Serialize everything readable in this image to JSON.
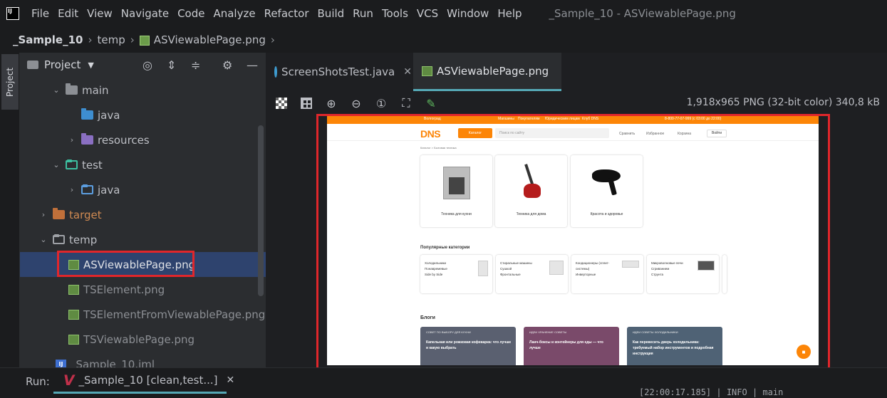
{
  "app": {
    "logo_text": "IJ",
    "window_title": "_Sample_10 - ASViewablePage.png"
  },
  "menu": [
    "File",
    "Edit",
    "View",
    "Navigate",
    "Code",
    "Analyze",
    "Refactor",
    "Build",
    "Run",
    "Tools",
    "VCS",
    "Window",
    "Help"
  ],
  "breadcrumbs": {
    "project": "_Sample_10",
    "folder": "temp",
    "file": "ASViewablePage.png"
  },
  "side_stripe": {
    "project_tab": "Project"
  },
  "project_panel": {
    "title": "Project",
    "tree": [
      {
        "label": "main"
      },
      {
        "label": "java"
      },
      {
        "label": "resources"
      },
      {
        "label": "test"
      },
      {
        "label": "java"
      },
      {
        "label": "target"
      },
      {
        "label": "temp"
      },
      {
        "label": "ASViewablePage.png"
      },
      {
        "label": "TSElement.png"
      },
      {
        "label": "TSElementFromViewablePage.png"
      },
      {
        "label": "TSViewablePage.png"
      },
      {
        "label": "_Sample_10.iml"
      }
    ]
  },
  "editor": {
    "tabs": [
      {
        "label": "ScreenShotsTest.java",
        "icon": "java-class-icon"
      },
      {
        "label": "ASViewablePage.png",
        "icon": "png-file-icon",
        "active": true
      }
    ],
    "image_info": "1,918x965 PNG (32-bit color) 340,8 kB"
  },
  "screenshot_content": {
    "topbar": [
      "Волгоград",
      "Магазины",
      "Покупателям",
      "Юридическим лицам",
      "Клуб DNS",
      "8-800-77-07-999 (с 03:00 до 22:00)"
    ],
    "logo": "DNS",
    "catalog_button": "Каталог",
    "search_placeholder": "Поиск по сайту",
    "nav": [
      "Сравнить",
      "Избранное",
      "Корзина"
    ],
    "login": "Войти",
    "breadcrumb": "Каталог  >  Бытовая техника",
    "categories": [
      "Техника для кухни",
      "Техника для дома",
      "Красота и здоровье"
    ],
    "popular_title": "Популярные категории",
    "popular": [
      {
        "line1": "Холодильники",
        "line2": "Понавремевые",
        "line3": "Side by Side"
      },
      {
        "line1": "Стиральные машины",
        "line2": "Сушкой",
        "line3": "Фронтальные"
      },
      {
        "line1": "Кондиционеры (сплит-",
        "line2": "системы)",
        "line3": "Инверторные"
      },
      {
        "line1": "Микроволновые печи",
        "line2": "Сгриванием",
        "line3": "Струнта"
      }
    ],
    "blogs_title": "Блоги",
    "blogs": [
      {
        "meta": "СОВЕТ ПО ВЫБОРУ  ДЛЯ КУХНИ",
        "title": "Капельная или рожковая кофеварка: что лучше и какую выбрать",
        "color": "#5a6070"
      },
      {
        "meta": "ИДЕИ  ХРАНЕНИЕ  СОВЕТЫ",
        "title": "Ланч-боксы и контейнеры для еды — что лучше",
        "color": "#7a4a6a"
      },
      {
        "meta": "ИДЕИ  СОВЕТЫ  ХОЛОДИЛЬНИКИ",
        "title": "Как перевесить дверь холодильника: требуемый набор инструментов и подробная инструкция",
        "color": "#4f6275"
      }
    ]
  },
  "run_bar": {
    "label": "Run:",
    "tab": "_Sample_10 [clean,test...]",
    "log_line": "[22:00:17.185] | INFO  | main"
  },
  "colors": {
    "accent_teal": "#55a8b5",
    "highlight_red": "#e0262b",
    "dns_orange": "#fc8507"
  }
}
